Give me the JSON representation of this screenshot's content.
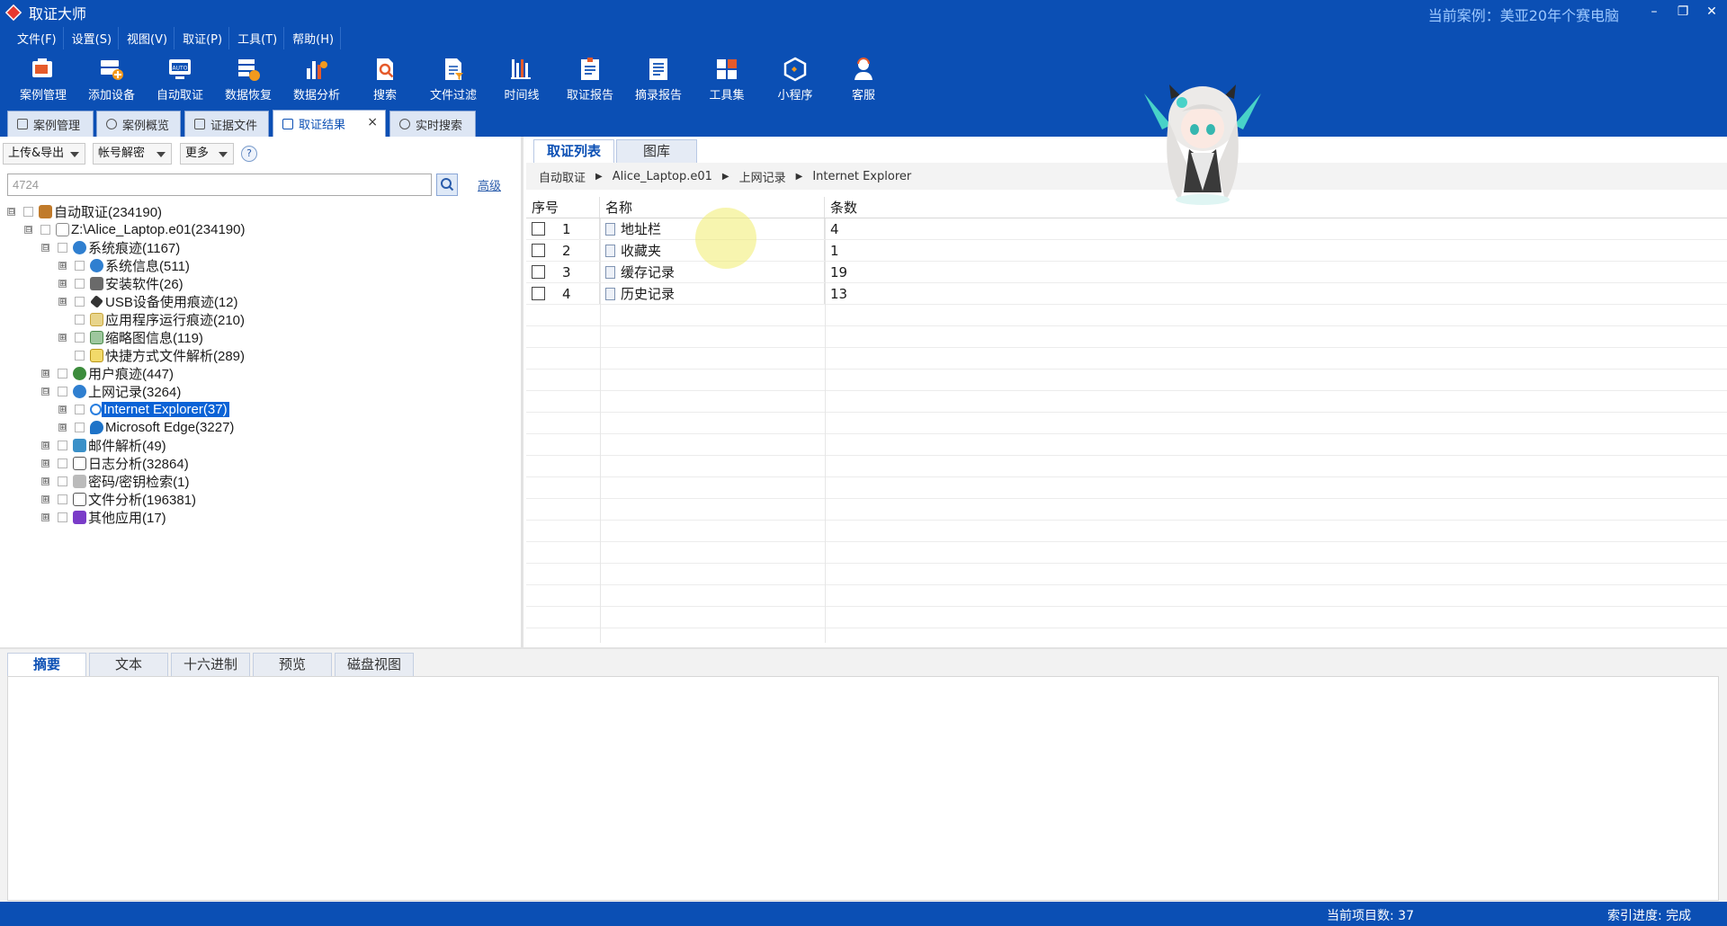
{
  "window": {
    "title": "取证大师",
    "current_case": "当前案例：美亚20年个赛电脑",
    "controls": [
      "–",
      "❐",
      "✕"
    ]
  },
  "menu": [
    "文件(F)",
    "设置(S)",
    "视图(V)",
    "取证(P)",
    "工具(T)",
    "帮助(H)"
  ],
  "toolbar": [
    {
      "label": "案例管理",
      "icon": "case-management-icon"
    },
    {
      "label": "添加设备",
      "icon": "add-device-icon"
    },
    {
      "label": "自动取证",
      "icon": "auto-forensics-icon"
    },
    {
      "label": "数据恢复",
      "icon": "data-recovery-icon"
    },
    {
      "label": "数据分析",
      "icon": "data-analysis-icon"
    },
    {
      "label": "搜索",
      "icon": "search-icon"
    },
    {
      "label": "文件过滤",
      "icon": "file-filter-icon"
    },
    {
      "label": "时间线",
      "icon": "timeline-icon"
    },
    {
      "label": "取证报告",
      "icon": "forensics-report-icon"
    },
    {
      "label": "摘录报告",
      "icon": "excerpt-report-icon"
    },
    {
      "label": "工具集",
      "icon": "toolset-icon"
    },
    {
      "label": "小程序",
      "icon": "mini-program-icon"
    },
    {
      "label": "客服",
      "icon": "customer-service-icon"
    }
  ],
  "doc_tabs": [
    {
      "label": "案例管理",
      "active": false
    },
    {
      "label": "案例概览",
      "active": false
    },
    {
      "label": "证据文件",
      "active": false
    },
    {
      "label": "取证结果",
      "active": true,
      "closable": true
    },
    {
      "label": "实时搜索",
      "active": false
    }
  ],
  "left_toolbar": {
    "dropdowns": [
      "上传&导出",
      "帐号解密",
      "更多"
    ],
    "help": "?",
    "search_value": "4724",
    "advanced_link": "高级"
  },
  "tree": [
    {
      "label": "自动取证(234190)",
      "expander": "⊟",
      "icon_color": "#c07a2a"
    },
    {
      "label": "Z:\\Alice_Laptop.e01(234190)",
      "expander": "⊟",
      "icon_color": "#8a8a8a"
    },
    {
      "label": "系统痕迹(1167)",
      "expander": "⊟",
      "icon_color": "#2f7fd0"
    },
    {
      "label": "系统信息(511)",
      "expander": "⊞",
      "icon_color": "#2f7fd0"
    },
    {
      "label": "安装软件(26)",
      "expander": "⊞",
      "icon_color": "#6a6a6a"
    },
    {
      "label": "USB设备使用痕迹(12)",
      "expander": "⊞",
      "icon_color": "#333333"
    },
    {
      "label": "应用程序运行痕迹(210)",
      "expander": "",
      "icon_color": "#c9a43a"
    },
    {
      "label": "缩略图信息(119)",
      "expander": "⊞",
      "icon_color": "#4a8a4a"
    },
    {
      "label": "快捷方式文件解析(289)",
      "expander": "",
      "icon_color": "#d4b02a"
    },
    {
      "label": "用户痕迹(447)",
      "expander": "⊞",
      "icon_color": "#3c8c3c"
    },
    {
      "label": "上网记录(3264)",
      "expander": "⊟",
      "icon_color": "#2f7fd0"
    },
    {
      "label": "Internet Explorer(37)",
      "expander": "⊞",
      "icon_color": "#2a7fe0",
      "selected": true
    },
    {
      "label": "Microsoft Edge(3227)",
      "expander": "⊞",
      "icon_color": "#1e73c8"
    },
    {
      "label": "邮件解析(49)",
      "expander": "⊞",
      "icon_color": "#3a90c8"
    },
    {
      "label": "日志分析(32864)",
      "expander": "⊞",
      "icon_color": "#555555"
    },
    {
      "label": "密码/密钥检索(1)",
      "expander": "⊞",
      "icon_color": "#777777"
    },
    {
      "label": "文件分析(196381)",
      "expander": "⊞",
      "icon_color": "#555555"
    },
    {
      "label": "其他应用(17)",
      "expander": "⊞",
      "icon_color": "#7a3cc8"
    }
  ],
  "right": {
    "tabs": [
      "取证列表",
      "图库"
    ],
    "breadcrumb": [
      "自动取证",
      "Alice_Laptop.e01",
      "上网记录",
      "Internet Explorer"
    ],
    "columns": [
      "序号",
      "名称",
      "条数"
    ],
    "rows": [
      {
        "index": "1",
        "name": "地址栏",
        "count": "4"
      },
      {
        "index": "2",
        "name": "收藏夹",
        "count": "1"
      },
      {
        "index": "3",
        "name": "缓存记录",
        "count": "19"
      },
      {
        "index": "4",
        "name": "历史记录",
        "count": "13"
      }
    ]
  },
  "detail_tabs": [
    "摘要",
    "文本",
    "十六进制",
    "预览",
    "磁盘视图"
  ],
  "status": {
    "count": "当前项目数: 37",
    "index": "索引进度: 完成"
  },
  "colors": {
    "brand_blue": "#0b4fb4",
    "selection": "#0b63d6"
  }
}
